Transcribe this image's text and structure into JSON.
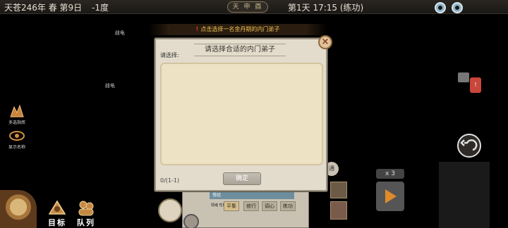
{
  "topbar": {
    "date": "天苍246年 春 第9日",
    "temperature": "-1度",
    "compass": "天 申 酉",
    "day_time": "第1天 17:15 (练功)"
  },
  "map": {
    "labels": [
      "雌龟",
      "雌龟",
      "雌龟"
    ]
  },
  "sidebar": {
    "items": [
      {
        "label": "多选指挥",
        "icon": "multi-select-icon"
      },
      {
        "label": "显示名称",
        "icon": "eye-icon"
      }
    ]
  },
  "bottom_nav": {
    "target_label": "目标",
    "team_label": "队列"
  },
  "notice": {
    "text": "点击选择一名金丹期的内门弟子"
  },
  "dialog": {
    "title": "请选择合适的内门弟子",
    "prompt": "请选择:",
    "count": "0/(1-1)",
    "confirm_label": "确定",
    "close_icon": "close-icon"
  },
  "background_panel": {
    "selected_name": "慢组",
    "tag": "情绪\n性格",
    "buttons": [
      "平集",
      "修行",
      "调心",
      "练功"
    ],
    "side_label": "通"
  },
  "controls": {
    "speed": "x 3"
  },
  "colors": {
    "notice_text": "#f0c050",
    "notice_bang": "#e53030",
    "dialog_bg": "#e3dccd",
    "list_bg": "#ede2c4",
    "play_arrow": "#e08a2a"
  }
}
